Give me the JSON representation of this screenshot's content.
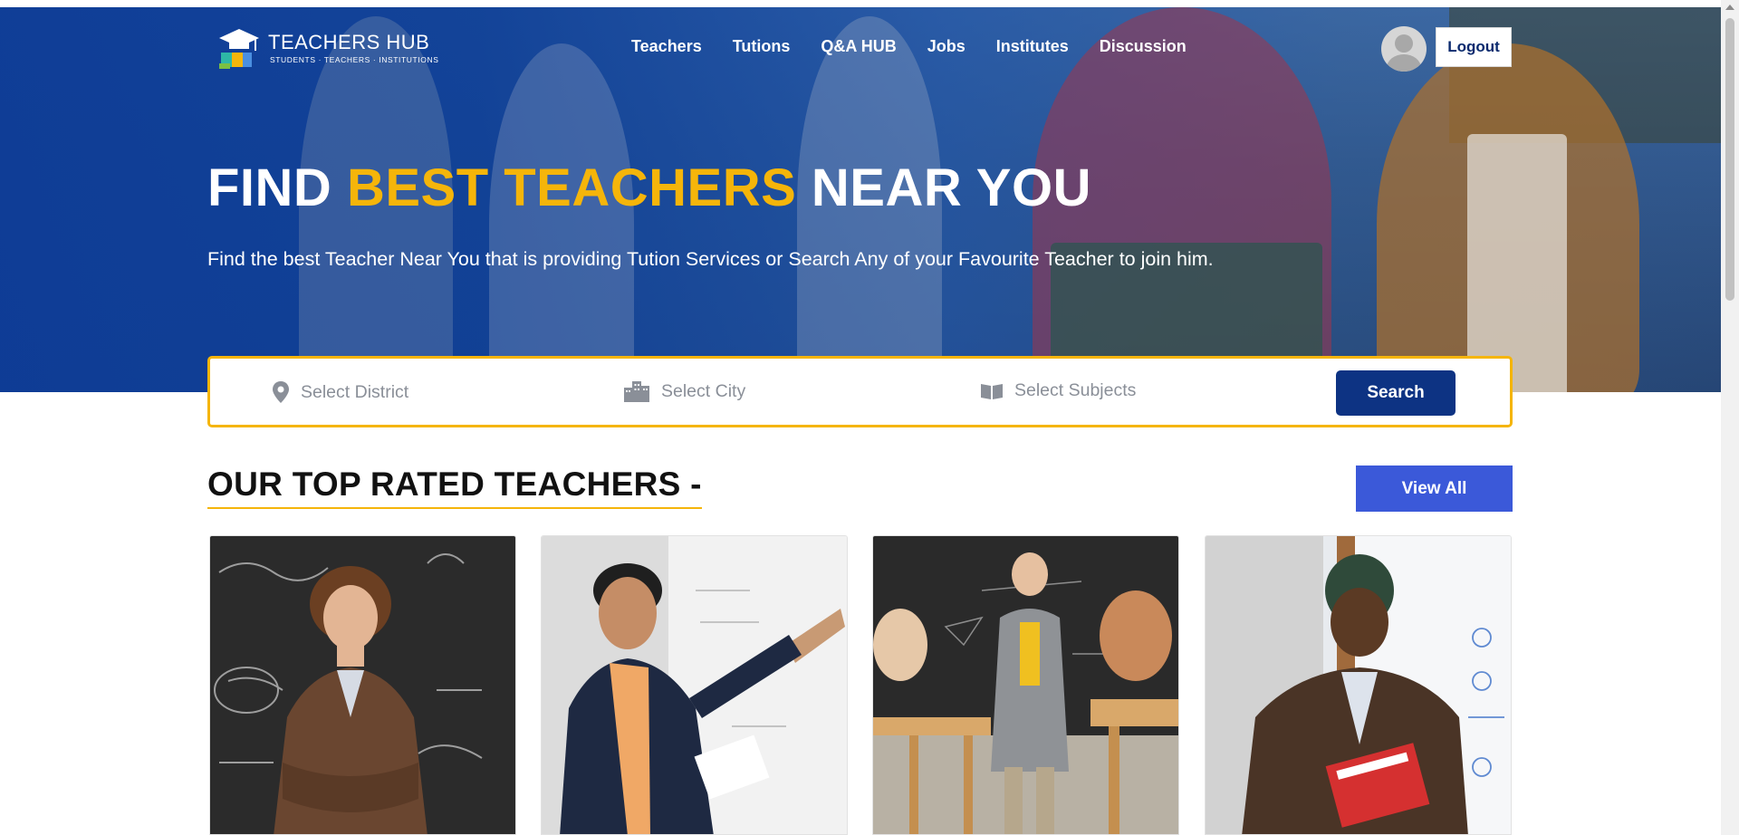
{
  "brand": {
    "name": "TEACHERS HUB",
    "tagline": "STUDENTS · TEACHERS · INSTITUTIONS"
  },
  "nav": {
    "items": [
      "Teachers",
      "Tutions",
      "Q&A HUB",
      "Jobs",
      "Institutes",
      "Discussion"
    ],
    "logout_label": "Logout"
  },
  "hero": {
    "title_part1": "FIND ",
    "title_highlight": "BEST TEACHERS",
    "title_part2": " NEAR YOU",
    "description": "Find the best Teacher Near You that is providing Tution Services or Search Any of your Favourite Teacher to join him."
  },
  "search": {
    "district_placeholder": "Select District",
    "city_placeholder": "Select City",
    "subjects_placeholder": "Select Subjects",
    "button_label": "Search"
  },
  "top_rated": {
    "title": "OUR TOP RATED TEACHERS -",
    "view_all_label": "View All"
  },
  "colors": {
    "primary_blue": "#0d3383",
    "accent_yellow": "#f5b50a",
    "view_all_blue": "#3b59d9"
  }
}
